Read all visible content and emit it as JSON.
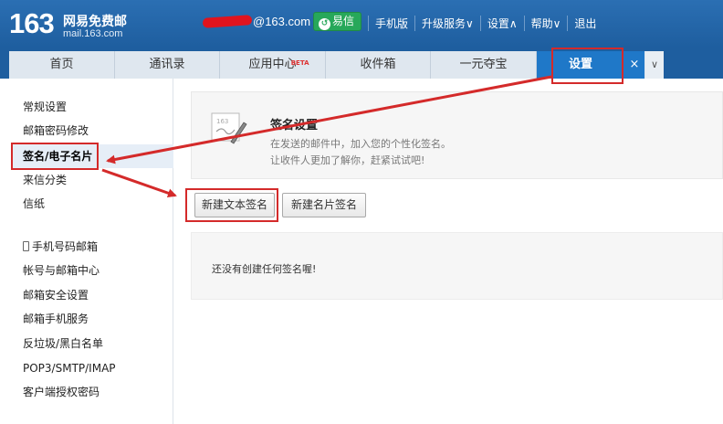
{
  "header": {
    "logo_number": "163",
    "logo_name": "网易免费邮",
    "logo_domain": "mail.163.com",
    "account_suffix": "@163.com",
    "yixin_label": "易信",
    "links": [
      "手机版",
      "升级服务∨",
      "设置∧",
      "帮助∨",
      "退出"
    ]
  },
  "tabs": [
    {
      "label": "首页"
    },
    {
      "label": "通讯录"
    },
    {
      "label": "应用中心",
      "badge": "BETA"
    },
    {
      "label": "收件箱"
    },
    {
      "label": "一元夺宝"
    },
    {
      "label": "设置",
      "active": true
    }
  ],
  "tab_close": "×",
  "sidebar": {
    "group1": [
      "常规设置",
      "邮箱密码修改",
      "签名/电子名片",
      "来信分类",
      "信纸"
    ],
    "group2": [
      "手机号码邮箱",
      "帐号与邮箱中心",
      "邮箱安全设置",
      "邮箱手机服务",
      "反垃圾/黑白名单",
      "POP3/SMTP/IMAP",
      "客户端授权密码"
    ],
    "active_index": 2
  },
  "signature": {
    "title": "签名设置",
    "desc1": "在发送的邮件中，加入您的个性化签名。",
    "desc2": "让收件人更加了解你，赶紧试试吧!",
    "icon_text": "163"
  },
  "buttons": {
    "new_text": "新建文本签名",
    "new_card": "新建名片签名"
  },
  "empty_message": "还没有创建任何签名喔!",
  "colors": {
    "header_blue": "#1e5e9f",
    "active_tab": "#1f78c8",
    "annotation_red": "#d42a2a"
  }
}
